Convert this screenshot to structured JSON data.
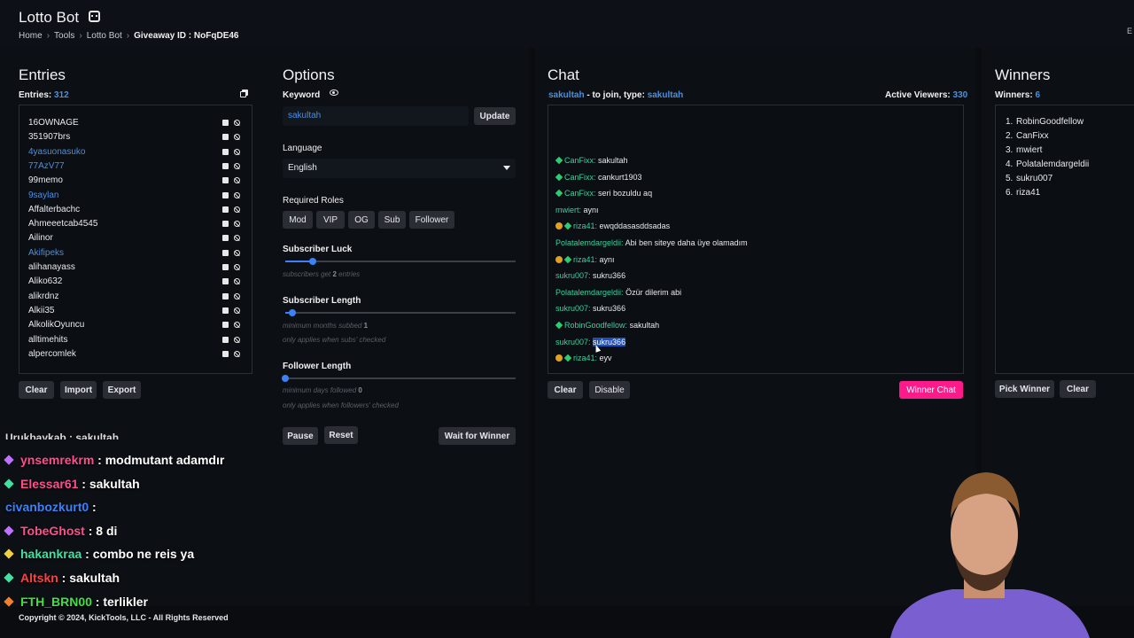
{
  "header": {
    "app_title": "Lotto Bot",
    "breadcrumb": [
      "Home",
      "Tools",
      "Lotto Bot"
    ],
    "giveaway_label": "Giveaway ID :",
    "giveaway_id": "NoFqDE46",
    "edge_char": "E"
  },
  "entries": {
    "title": "Entries",
    "count_label": "Entries:",
    "count": "312",
    "items": [
      {
        "name": "16OWNAGE",
        "highlight": false
      },
      {
        "name": "351907brs",
        "highlight": false
      },
      {
        "name": "4yasuonasuko",
        "highlight": true
      },
      {
        "name": "77AzV77",
        "highlight": true
      },
      {
        "name": "99memo",
        "highlight": false
      },
      {
        "name": "9saylan",
        "highlight": true
      },
      {
        "name": "Affalterbachc",
        "highlight": false
      },
      {
        "name": "Ahmeeetcab4545",
        "highlight": false
      },
      {
        "name": "Ailinor",
        "highlight": false
      },
      {
        "name": "Akifipeks",
        "highlight": true
      },
      {
        "name": "alihanayass",
        "highlight": false
      },
      {
        "name": "Aliko632",
        "highlight": false
      },
      {
        "name": "alikrdnz",
        "highlight": false
      },
      {
        "name": "Alkii35",
        "highlight": false
      },
      {
        "name": "AlkolikOyuncu",
        "highlight": false
      },
      {
        "name": "alltimehits",
        "highlight": false
      },
      {
        "name": "alpercomlek",
        "highlight": false
      }
    ],
    "buttons": {
      "clear": "Clear",
      "import": "Import",
      "export": "Export"
    }
  },
  "options": {
    "title": "Options",
    "keyword_label": "Keyword",
    "keyword_value": "sakultah",
    "update_button": "Update",
    "language_label": "Language",
    "language_value": "English",
    "roles_label": "Required Roles",
    "roles": [
      "Mod",
      "VIP",
      "OG",
      "Sub",
      "Follower"
    ],
    "sub_luck_label": "Subscriber Luck",
    "sub_luck_hint_pre": "subscribers get",
    "sub_luck_value": "2",
    "sub_luck_hint_post": "entries",
    "sub_luck_level": 0.12,
    "sub_length_label": "Subscriber Length",
    "sub_length_hint_pre": "minimum months subbed",
    "sub_length_value": "1",
    "sub_length_note": "only applies when subs' checked",
    "sub_length_level": 0.03,
    "follower_length_label": "Follower Length",
    "follower_length_hint_pre": "minimum days followed",
    "follower_length_value": "0",
    "follower_length_note": "only applies when followers' checked",
    "follower_length_level": 0.0,
    "buttons": {
      "pause": "Pause",
      "reset": "Reset",
      "wait": "Wait for Winner"
    }
  },
  "chat": {
    "title": "Chat",
    "keyword": "sakultah",
    "join_text": "- to join, type:",
    "join_keyword": "sakultah",
    "viewers_label": "Active Viewers:",
    "viewers_count": "330",
    "messages": [
      {
        "user": "CanFixx",
        "text": "sakultah",
        "badge": false,
        "diamond": true,
        "selected": false
      },
      {
        "user": "CanFixx",
        "text": "cankurt1903",
        "badge": false,
        "diamond": true,
        "selected": false
      },
      {
        "user": "CanFixx",
        "text": "seri bozuldu aq",
        "badge": false,
        "diamond": true,
        "selected": false
      },
      {
        "user": "mwiert",
        "text": "aynı",
        "badge": false,
        "diamond": false,
        "selected": false
      },
      {
        "user": "riza41",
        "text": "ewqddasasddsadas",
        "badge": true,
        "diamond": true,
        "selected": false
      },
      {
        "user": "Polatalemdargeldii",
        "text": "Abi ben siteye daha üye olamadım",
        "badge": false,
        "diamond": false,
        "selected": false
      },
      {
        "user": "riza41",
        "text": "aynı",
        "badge": true,
        "diamond": true,
        "selected": false
      },
      {
        "user": "sukru007",
        "text": "sukru366",
        "badge": false,
        "diamond": false,
        "selected": false
      },
      {
        "user": "Polatalemdargeldii",
        "text": "Özür dilerim abi",
        "badge": false,
        "diamond": false,
        "selected": false
      },
      {
        "user": "sukru007",
        "text": "sukru366",
        "badge": false,
        "diamond": false,
        "selected": false
      },
      {
        "user": "RobinGoodfellow",
        "text": "sakultah",
        "badge": false,
        "diamond": true,
        "selected": false
      },
      {
        "user": "sukru007",
        "text": "sukru366",
        "badge": false,
        "diamond": false,
        "selected": true
      },
      {
        "user": "riza41",
        "text": "eyv",
        "badge": true,
        "diamond": true,
        "selected": false
      }
    ],
    "buttons": {
      "clear": "Clear",
      "disable": "Disable",
      "winner_chat": "Winner Chat"
    },
    "colors": {
      "accent": "#ff1a8c",
      "user": "#3ecf9e",
      "link": "#4a90e2"
    }
  },
  "winners": {
    "title": "Winners",
    "count_label": "Winners:",
    "count": "6",
    "items": [
      "RobinGoodfellow",
      "CanFixx",
      "mwiert",
      "Polatalemdargeldii",
      "sukru007",
      "riza41"
    ],
    "buttons": {
      "pick": "Pick Winner",
      "clear": "Clear"
    }
  },
  "stream_chat": [
    {
      "user": "ynsemrekrm",
      "text": "modmutant adamdır",
      "color": "#ff4f8b",
      "dia": "#c070ff"
    },
    {
      "user": "Elessar61",
      "text": "sakultah",
      "color": "#ff4f8b",
      "dia": "#43e0a0"
    },
    {
      "user": "civanbozkurt0",
      "text": "",
      "color": "#3b82f6",
      "dia": ""
    },
    {
      "user": "TobeGhost",
      "text": "8 di",
      "color": "#ff4f8b",
      "dia": "#c070ff"
    },
    {
      "user": "hakankraa",
      "text": "combo ne reis ya",
      "color": "#43e0a0",
      "dia": "#f0d040"
    },
    {
      "user": "Altskn",
      "text": "sakultah",
      "color": "#ff4040",
      "dia": "#43e0a0"
    },
    {
      "user": "FTH_BRN00",
      "text": "terlikler",
      "color": "#40e040",
      "dia": "#f08030"
    }
  ],
  "stream_partial": "Urukbaykab : sakultah",
  "footer": "Copyright © 2024, KickTools, LLC - All Rights Reserved"
}
